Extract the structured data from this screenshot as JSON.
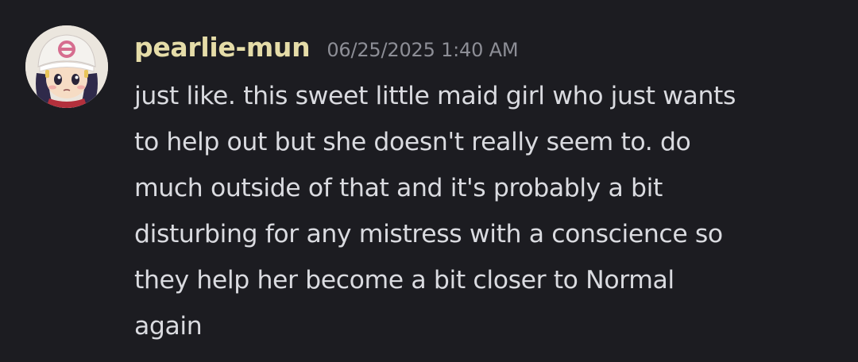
{
  "message": {
    "username": "pearlie-mun",
    "timestamp": "06/25/2025 1:40 AM",
    "avatar_icon": "anime-girl-avatar-icon",
    "lines": [
      "just like. this sweet little maid girl who just wants",
      "to help out but she doesn't really seem to. do",
      "much outside of that and it's probably a bit",
      "disturbing for any mistress with a conscience so",
      "they help her become a bit closer to Normal",
      "again"
    ]
  },
  "colors": {
    "background": "#1c1c21",
    "username": "#e5dca8",
    "timestamp": "#8d8e96",
    "text": "#dadbe0"
  }
}
